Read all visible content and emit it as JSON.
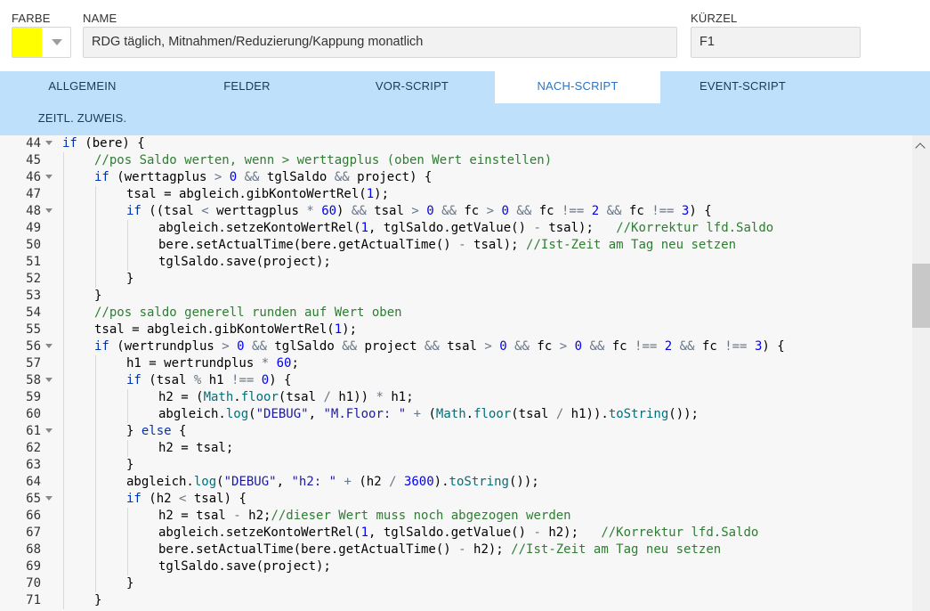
{
  "header": {
    "color_label": "FARBE",
    "color_value": "#ffff00",
    "name_label": "NAME",
    "name_value": "RDG täglich, Mitnahmen/Reduzierung/Kappung monatlich",
    "short_label": "KÜRZEL",
    "short_value": "F1"
  },
  "tabs": [
    {
      "label": "ALLGEMEIN",
      "active": false
    },
    {
      "label": "FELDER",
      "active": false
    },
    {
      "label": "VOR-SCRIPT",
      "active": false
    },
    {
      "label": "NACH-SCRIPT",
      "active": true
    },
    {
      "label": "EVENT-SCRIPT",
      "active": false
    },
    {
      "label": "ZEITL. ZUWEIS.",
      "active": false
    }
  ],
  "code_lines": [
    {
      "n": "44",
      "fold": true,
      "indent": 0,
      "text": "if (bere) {"
    },
    {
      "n": "45",
      "fold": false,
      "indent": 1,
      "text": "//pos Saldo werten, wenn > werttagplus (oben Wert einstellen)"
    },
    {
      "n": "46",
      "fold": true,
      "indent": 1,
      "text": "if (werttagplus > 0 && tglSaldo && project) {"
    },
    {
      "n": "47",
      "fold": false,
      "indent": 2,
      "text": "tsal = abgleich.gibKontoWertRel(1);"
    },
    {
      "n": "48",
      "fold": true,
      "indent": 2,
      "text": "if ((tsal < werttagplus * 60) && tsal > 0 && fc > 0 && fc !== 2 && fc !== 3) {"
    },
    {
      "n": "49",
      "fold": false,
      "indent": 3,
      "text": "abgleich.setzeKontoWertRel(1, tglSaldo.getValue() - tsal);   //Korrektur lfd.Saldo"
    },
    {
      "n": "50",
      "fold": false,
      "indent": 3,
      "text": "bere.setActualTime(bere.getActualTime() - tsal); //Ist-Zeit am Tag neu setzen"
    },
    {
      "n": "51",
      "fold": false,
      "indent": 3,
      "text": "tglSaldo.save(project);"
    },
    {
      "n": "52",
      "fold": false,
      "indent": 2,
      "text": "}"
    },
    {
      "n": "53",
      "fold": false,
      "indent": 1,
      "text": "}"
    },
    {
      "n": "54",
      "fold": false,
      "indent": 1,
      "text": "//pos saldo generell runden auf Wert oben"
    },
    {
      "n": "55",
      "fold": false,
      "indent": 1,
      "text": "tsal = abgleich.gibKontoWertRel(1);"
    },
    {
      "n": "56",
      "fold": true,
      "indent": 1,
      "text": "if (wertrundplus > 0 && tglSaldo && project && tsal > 0 && fc > 0 && fc !== 2 && fc !== 3) {"
    },
    {
      "n": "57",
      "fold": false,
      "indent": 2,
      "text": "h1 = wertrundplus * 60;"
    },
    {
      "n": "58",
      "fold": true,
      "indent": 2,
      "text": "if (tsal % h1 !== 0) {"
    },
    {
      "n": "59",
      "fold": false,
      "indent": 3,
      "text": "h2 = (Math.floor(tsal / h1)) * h1;"
    },
    {
      "n": "60",
      "fold": false,
      "indent": 3,
      "text": "abgleich.log(\"DEBUG\", \"M.Floor: \" + (Math.floor(tsal / h1)).toString());"
    },
    {
      "n": "61",
      "fold": true,
      "indent": 2,
      "text": "} else {"
    },
    {
      "n": "62",
      "fold": false,
      "indent": 3,
      "text": "h2 = tsal;"
    },
    {
      "n": "63",
      "fold": false,
      "indent": 2,
      "text": "}"
    },
    {
      "n": "64",
      "fold": false,
      "indent": 2,
      "text": "abgleich.log(\"DEBUG\", \"h2: \" + (h2 / 3600).toString());"
    },
    {
      "n": "65",
      "fold": true,
      "indent": 2,
      "text": "if (h2 < tsal) {"
    },
    {
      "n": "66",
      "fold": false,
      "indent": 3,
      "text": "h2 = tsal - h2;//dieser Wert muss noch abgezogen werden"
    },
    {
      "n": "67",
      "fold": false,
      "indent": 3,
      "text": "abgleich.setzeKontoWertRel(1, tglSaldo.getValue() - h2);   //Korrektur lfd.Saldo"
    },
    {
      "n": "68",
      "fold": false,
      "indent": 3,
      "text": "bere.setActualTime(bere.getActualTime() - h2); //Ist-Zeit am Tag neu setzen"
    },
    {
      "n": "69",
      "fold": false,
      "indent": 3,
      "text": "tglSaldo.save(project);"
    },
    {
      "n": "70",
      "fold": false,
      "indent": 2,
      "text": "}"
    },
    {
      "n": "71",
      "fold": false,
      "indent": 1,
      "text": "}"
    }
  ],
  "scrollbar": {
    "position": 0.28
  }
}
